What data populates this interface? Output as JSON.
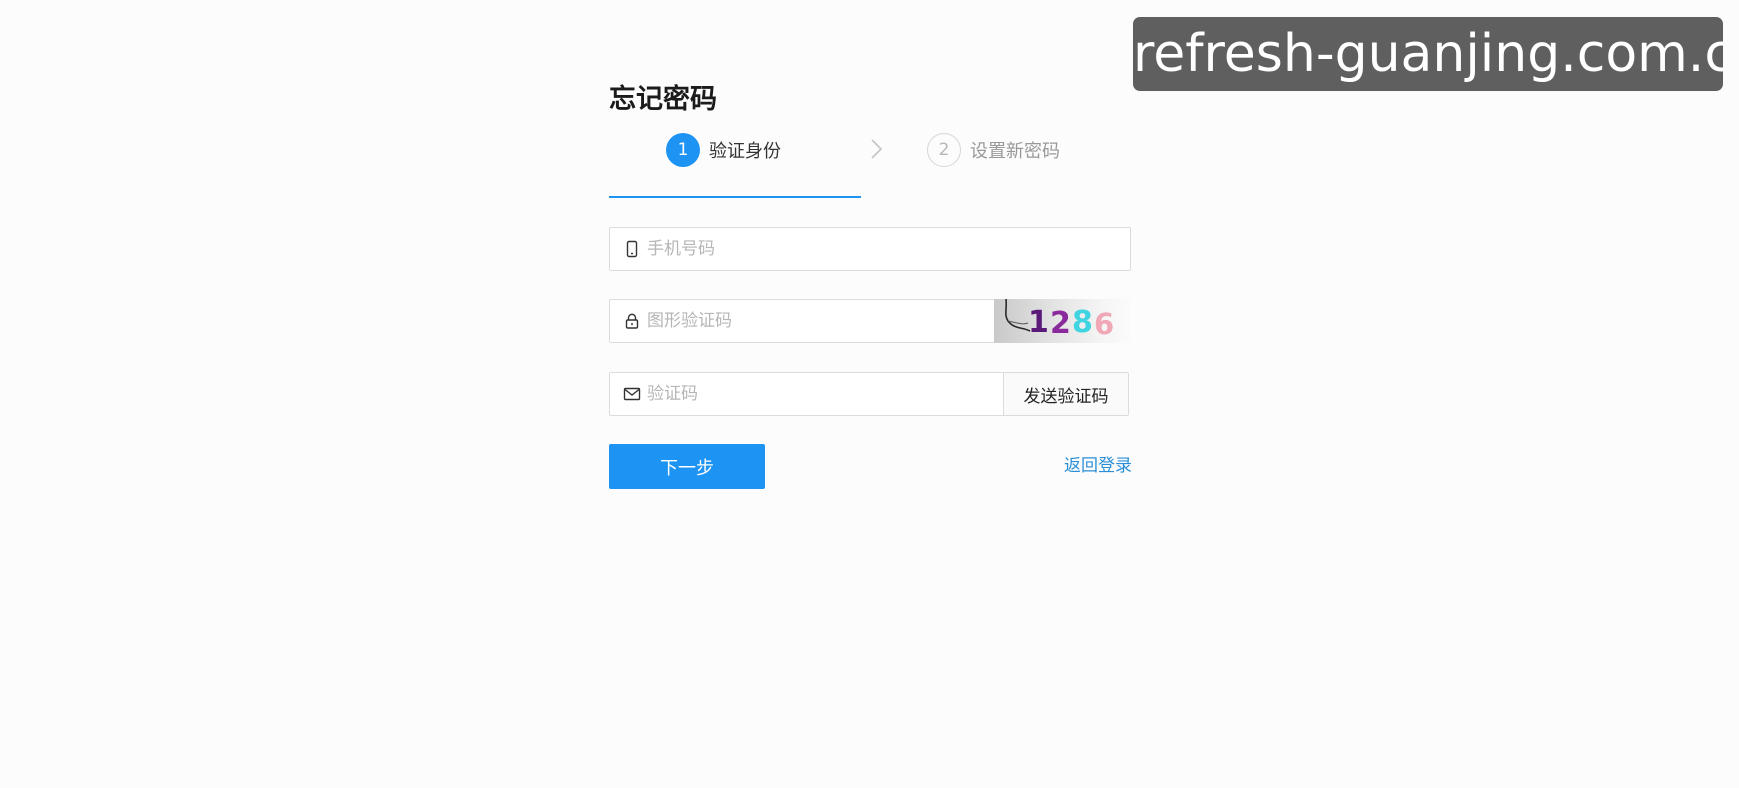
{
  "watermark": {
    "text": "refresh-guanjing.com.cn"
  },
  "form": {
    "title": "忘记密码",
    "steps": [
      {
        "number": "1",
        "label": "验证身份",
        "active": true
      },
      {
        "number": "2",
        "label": "设置新密码",
        "active": false
      }
    ],
    "phone_field": {
      "placeholder": "手机号码",
      "value": ""
    },
    "captcha_field": {
      "placeholder": "图形验证码",
      "value": "",
      "captcha_digits": [
        "1",
        "2",
        "8",
        "6"
      ]
    },
    "code_field": {
      "placeholder": "验证码",
      "value": ""
    },
    "send_code_label": "发送验证码",
    "next_label": "下一步",
    "back_login_label": "返回登录"
  },
  "colors": {
    "primary": "#1d93f3",
    "link": "#2b8fd8",
    "captcha_digit_1": "#5b1a7a",
    "captcha_digit_2": "#8a2a9c",
    "captcha_digit_3": "#3fd4e0",
    "captcha_digit_4": "#f0a0b0"
  },
  "icons": {
    "phone_field": "mobile-phone-icon",
    "captcha_field": "lock-icon",
    "code_field": "envelope-icon",
    "step_separator": "chevron-right-icon"
  }
}
